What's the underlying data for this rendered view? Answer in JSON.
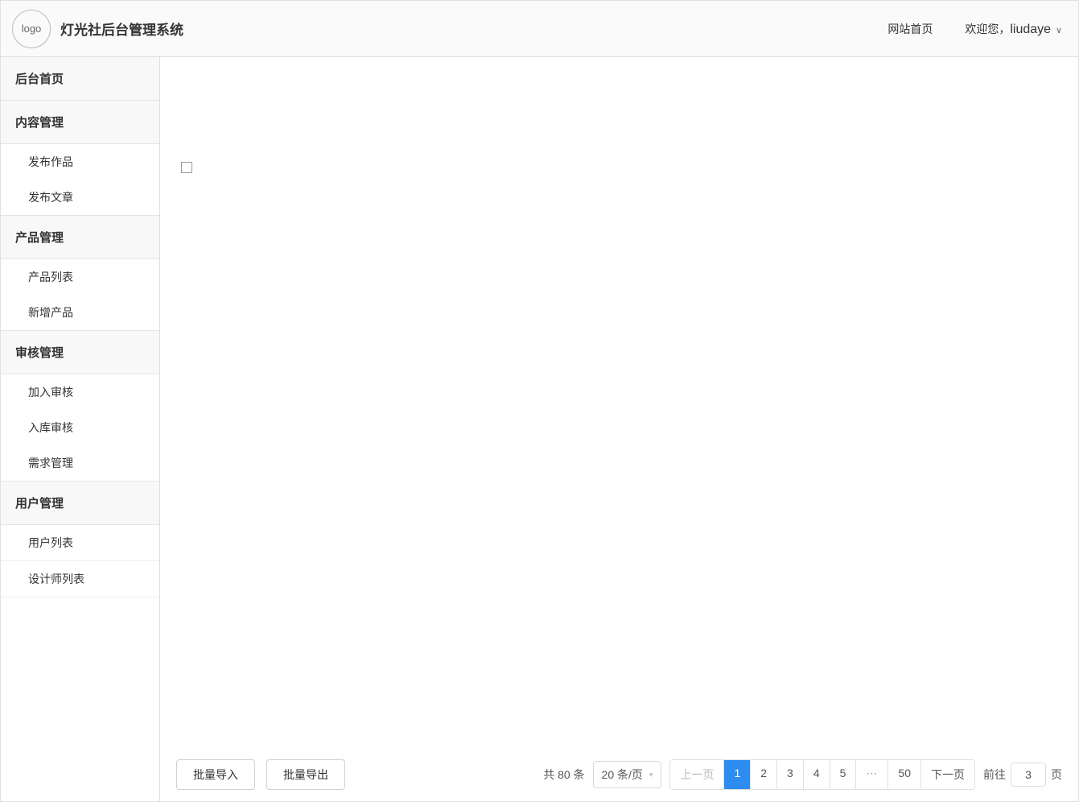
{
  "header": {
    "logo_text": "logo",
    "title": "灯光社后台管理系统",
    "home_link": "网站首页",
    "welcome_prefix": "欢迎您，",
    "username": "liudaye"
  },
  "sidebar": {
    "sections": [
      {
        "label": "后台首页",
        "items": []
      },
      {
        "label": "内容管理",
        "items": [
          "发布作品",
          "发布文章"
        ]
      },
      {
        "label": "产品管理",
        "items": [
          "产品列表",
          "新增产品"
        ]
      },
      {
        "label": "审核管理",
        "items": [
          "加入审核",
          "入库审核",
          "需求管理"
        ]
      },
      {
        "label": "用户管理",
        "items": [
          "用户列表",
          "设计师列表"
        ]
      }
    ]
  },
  "footer": {
    "batch_import": "批量导入",
    "batch_export": "批量导出",
    "total_text": "共 80 条",
    "page_size_text": "20 条/页",
    "prev": "上一页",
    "next": "下一页",
    "pages": [
      "1",
      "2",
      "3",
      "4",
      "5",
      "50"
    ],
    "ellipsis": "⋯",
    "goto_prefix": "前往",
    "goto_value": "3",
    "goto_suffix": "页"
  }
}
